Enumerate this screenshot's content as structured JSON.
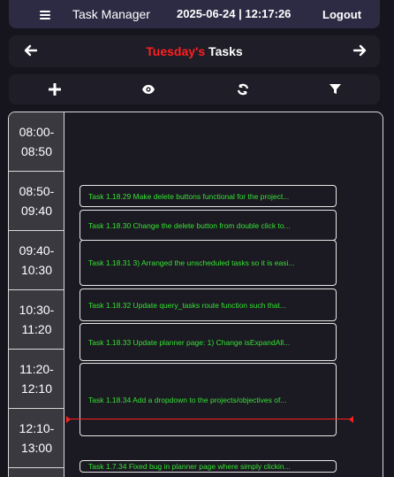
{
  "header": {
    "app_title": "Task Manager",
    "date": "2025-06-24",
    "time": "12:17:26",
    "logout_label": "Logout"
  },
  "day_nav": {
    "day_name": "Tuesday's",
    "suffix": " Tasks"
  },
  "toolbar": {
    "icons": [
      "plus-icon",
      "eye-icon",
      "refresh-icon",
      "filter-icon"
    ]
  },
  "time_slots": [
    "08:00-\n08:50",
    "08:50-\n09:40",
    "09:40-\n10:30",
    "10:30-\n11:20",
    "11:20-\n12:10",
    "12:10-\n13:00"
  ],
  "tasks": [
    "Task 1.18.29 Make delete buttons functional for the project...",
    "Task 1.18.30 Change the delete button from double click to...",
    "Task 1.18.31 3) Arranged the unscheduled tasks so it is easi...",
    "Task 1.18.32 Update query_tasks route function such that...",
    "Task 1.18.33 Update planner page: 1) Change isExpandAll...",
    "Task 1.18.34 Add a dropdown to the projects/objectives of...",
    "Task 1.7.34 Fixed bug in planner page where simply clickin..."
  ],
  "colors": {
    "accent_red": "#ff1f1f",
    "task_green": "#35e335",
    "header_bg": "#2d2b44"
  }
}
